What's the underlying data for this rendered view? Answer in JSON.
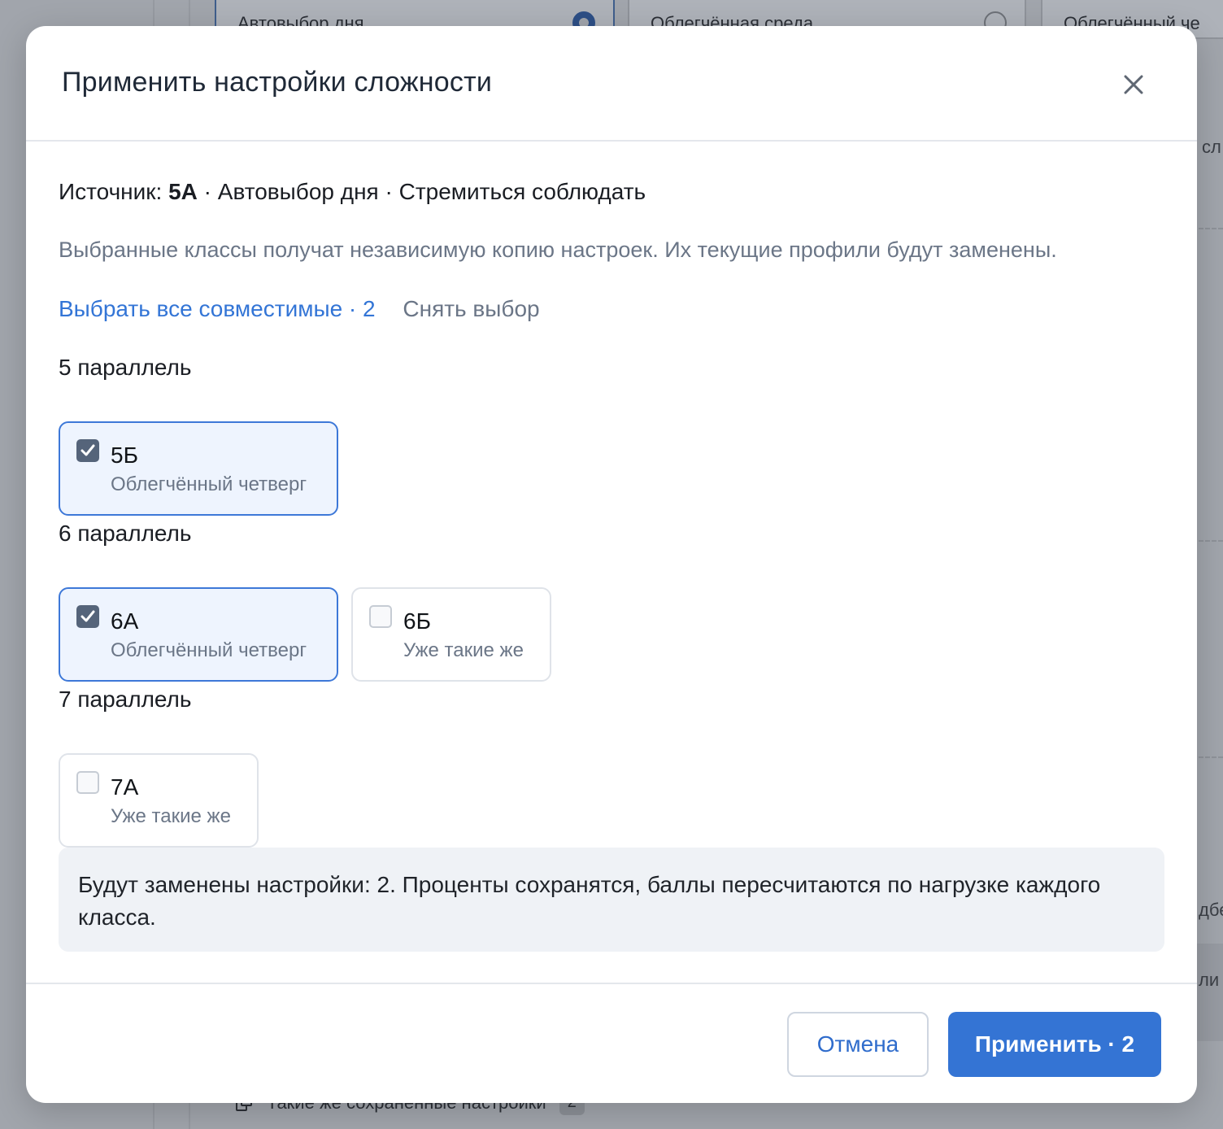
{
  "background": {
    "cards": [
      {
        "label": "Автовыбор дня",
        "active": true
      },
      {
        "label": "Облегчённая среда",
        "active": false
      },
      {
        "label": "Облегчённый че",
        "active": false
      }
    ],
    "right_fragments": [
      "сл",
      "дбе",
      "ли п"
    ],
    "bottom_row": {
      "label": "Такие же сохранённые настройки",
      "badge": "2"
    }
  },
  "modal": {
    "title": "Применить настройки сложности",
    "source": {
      "prefix": "Источник: ",
      "class": "5А",
      "rest": " · Автовыбор дня · Стремиться соблюдать"
    },
    "hint": "Выбранные классы получат независимую копию настроек. Их текущие профили будут заменены.",
    "select_all_label": "Выбрать все совместимые · 2",
    "clear_label": "Снять выбор",
    "groups": [
      {
        "title": "5 параллель",
        "classes": [
          {
            "name": "5Б",
            "status": "Облегчённый четверг",
            "checked": true
          }
        ]
      },
      {
        "title": "6 параллель",
        "classes": [
          {
            "name": "6А",
            "status": "Облегчённый четверг",
            "checked": true
          },
          {
            "name": "6Б",
            "status": "Уже такие же",
            "checked": false
          }
        ]
      },
      {
        "title": "7 параллель",
        "classes": [
          {
            "name": "7А",
            "status": "Уже такие же",
            "checked": false
          }
        ]
      }
    ],
    "notice": "Будут заменены настройки: 2. Проценты сохранятся, баллы пересчитаются по нагрузке каждого класса.",
    "cancel_label": "Отмена",
    "apply_label": "Применить · 2"
  },
  "colors": {
    "accent": "#3474d4",
    "checked_bg": "#eef4fe",
    "muted_text": "#6b7687",
    "overlay": "#a1a5ac"
  }
}
